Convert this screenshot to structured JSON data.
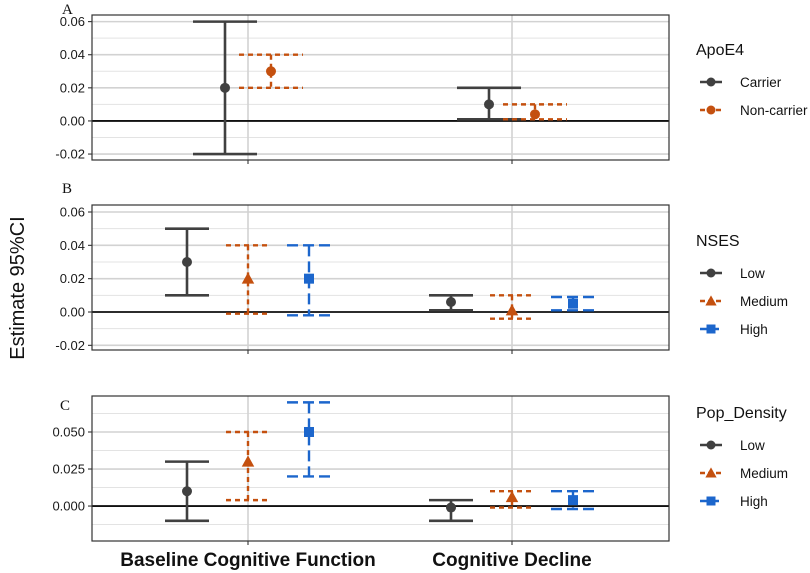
{
  "chart_data": {
    "type": "errorbar",
    "ylabel": "Estimate 95%CI",
    "categories": [
      "Baseline Cognitive Function",
      "Cognitive Decline"
    ],
    "colors": {
      "Carrier": "#404040",
      "Non-carrier": "#C4500F",
      "Low": "#404040",
      "Medium": "#C4500F",
      "High": "#1C66CC"
    },
    "panels": [
      {
        "letter": "A",
        "legend_title": "ApoE4",
        "ylim": [
          -0.0236,
          0.064
        ],
        "yticks": [
          -0.02,
          0.0,
          0.02,
          0.04,
          0.06
        ],
        "ytick_labels": [
          "-0.02",
          "0.00",
          "0.02",
          "0.04",
          "0.06"
        ],
        "series": [
          {
            "name": "Carrier",
            "shape": "circle",
            "line": "solid",
            "estimate": [
              0.02,
              0.01
            ],
            "lower": [
              -0.02,
              0.001
            ],
            "upper": [
              0.06,
              0.02
            ]
          },
          {
            "name": "Non-carrier",
            "shape": "circle",
            "line": "dotted",
            "estimate": [
              0.03,
              0.004
            ],
            "lower": [
              0.02,
              0.001
            ],
            "upper": [
              0.04,
              0.01
            ]
          }
        ]
      },
      {
        "letter": "B",
        "legend_title": "NSES",
        "ylim": [
          -0.0228,
          0.0642
        ],
        "yticks": [
          -0.02,
          0.0,
          0.02,
          0.04,
          0.06
        ],
        "ytick_labels": [
          "-0.02",
          "0.00",
          "0.02",
          "0.04",
          "0.06"
        ],
        "series": [
          {
            "name": "Low",
            "shape": "circle",
            "line": "solid",
            "estimate": [
              0.03,
              0.006
            ],
            "lower": [
              0.01,
              0.001
            ],
            "upper": [
              0.05,
              0.01
            ]
          },
          {
            "name": "Medium",
            "shape": "triangle",
            "line": "dotted",
            "estimate": [
              0.02,
              0.001
            ],
            "lower": [
              -0.001,
              -0.004
            ],
            "upper": [
              0.04,
              0.01
            ]
          },
          {
            "name": "High",
            "shape": "square",
            "line": "dashed",
            "estimate": [
              0.02,
              0.005
            ],
            "lower": [
              -0.002,
              0.001
            ],
            "upper": [
              0.04,
              0.009
            ]
          }
        ]
      },
      {
        "letter": "C",
        "legend_title": "Pop_Density",
        "ylim": [
          -0.0236,
          0.0743
        ],
        "yticks": [
          0.0,
          0.025,
          0.05
        ],
        "ytick_labels": [
          "0.000",
          "0.025",
          "0.050"
        ],
        "series": [
          {
            "name": "Low",
            "shape": "circle",
            "line": "solid",
            "estimate": [
              0.01,
              -0.001
            ],
            "lower": [
              -0.01,
              -0.01
            ],
            "upper": [
              0.03,
              0.004
            ]
          },
          {
            "name": "Medium",
            "shape": "triangle",
            "line": "dotted",
            "estimate": [
              0.03,
              0.006
            ],
            "lower": [
              0.004,
              -0.001
            ],
            "upper": [
              0.05,
              0.01
            ]
          },
          {
            "name": "High",
            "shape": "square",
            "line": "dashed",
            "estimate": [
              0.05,
              0.004
            ],
            "lower": [
              0.02,
              -0.002
            ],
            "upper": [
              0.07,
              0.01
            ]
          }
        ]
      }
    ]
  }
}
